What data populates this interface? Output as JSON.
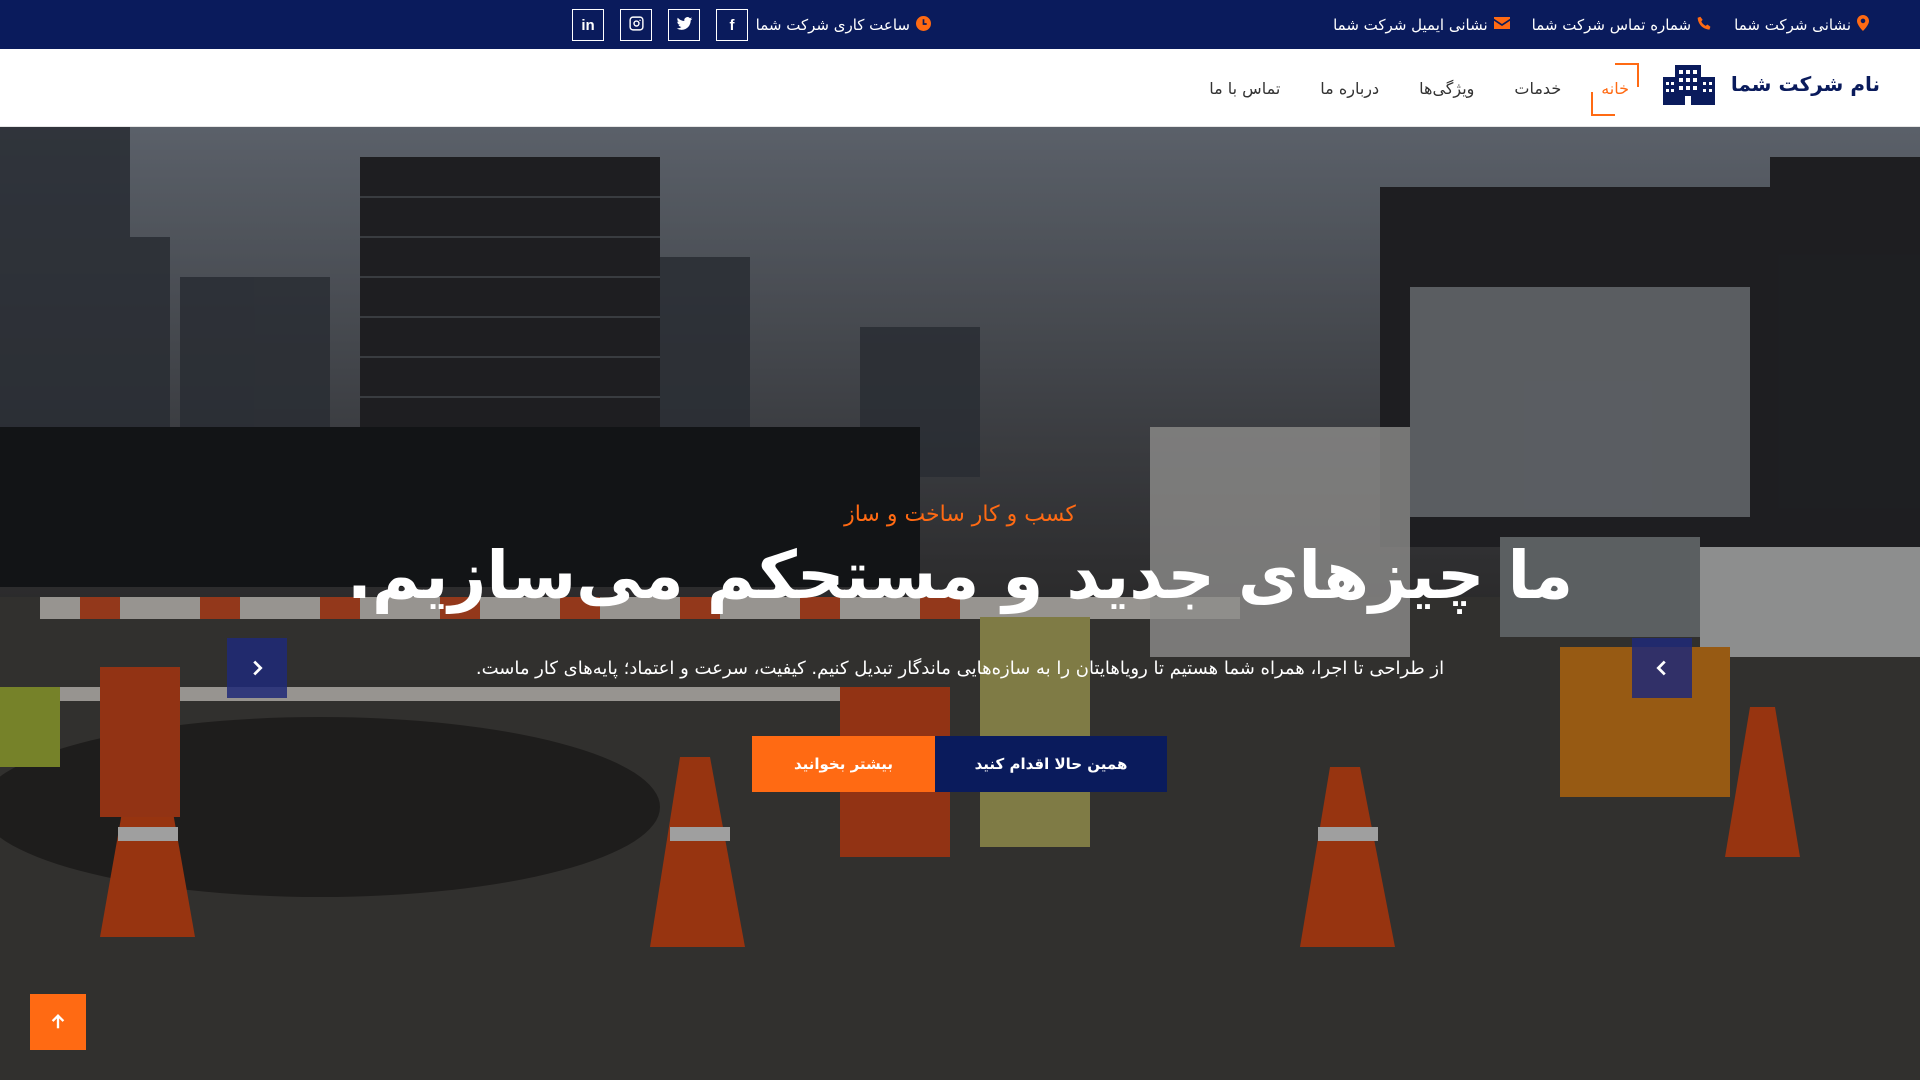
{
  "topbar": {
    "address": "نشانی شرکت شما",
    "phone": "شماره تماس شرکت شما",
    "email": "نشانی ایمیل شرکت شما",
    "hours": "ساعت کاری شرکت شما",
    "socials": [
      {
        "icon": "facebook-icon",
        "glyph": "f"
      },
      {
        "icon": "twitter-icon",
        "glyph": ""
      },
      {
        "icon": "instagram-icon",
        "glyph": ""
      },
      {
        "icon": "linkedin-icon",
        "glyph": "in"
      }
    ]
  },
  "navbar": {
    "brand_name": "نام شرکت شما",
    "items": [
      {
        "label": "خانه",
        "active": true
      },
      {
        "label": "خدمات",
        "active": false
      },
      {
        "label": "ویژگی‌ها",
        "active": false
      },
      {
        "label": "درباره ما",
        "active": false
      },
      {
        "label": "تماس با ما",
        "active": false
      }
    ]
  },
  "hero": {
    "subtitle": "کسب و کار ساخت و ساز",
    "title": "ما چیزهای جدید و مستحکم می‌سازیم.",
    "description": "از طراحی تا اجرا، همراه شما هستیم تا رویاهایتان را به سازه‌هایی ماندگار تبدیل کنیم. کیفیت، سرعت و اعتماد؛ پایه‌های کار ماست.",
    "btn_read_more": "بیشتر بخوانید",
    "btn_act_now": "همین حالا اقدام کنید"
  },
  "colors": {
    "navy": "#0a1b5c",
    "accent_orange": "#ff6a13",
    "white": "#ffffff"
  }
}
